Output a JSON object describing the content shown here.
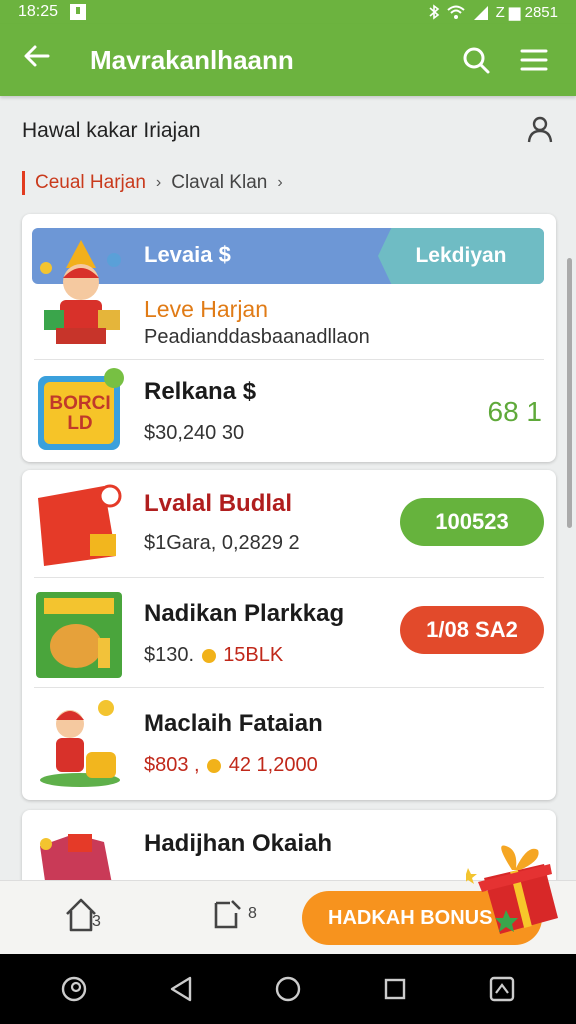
{
  "status_bar": {
    "time": "18:25",
    "right_text": "Z ▆ 2851"
  },
  "app_bar": {
    "title": "Mavrakanlhaann"
  },
  "subheader": {
    "title": "Hawal kakar Iriajan"
  },
  "breadcrumb": {
    "item1": "Ceual Harjan",
    "item2": "Claval Klan"
  },
  "card1": {
    "banner_left": "Levaia $",
    "banner_right": "Lekdiyan",
    "row1": {
      "title": "Leve Harjan",
      "subtitle": "Peadianddasbaanadllaon"
    },
    "row2": {
      "title": "Relkana $",
      "subtitle": "$30,240 30",
      "value": "68 1",
      "thumb_text": "BORCI LD"
    }
  },
  "card2": {
    "row1": {
      "title": "Lvalal Budlal",
      "subtitle": "$1Gara, 0,2829 2",
      "pill": "100523"
    },
    "row2": {
      "title": "Nadikan Plarkkag",
      "subtitle_prefix": "$130.",
      "subtitle_red": "15BLK",
      "pill": "1/08 SA2"
    },
    "row3": {
      "title": "Maclaih Fataian",
      "subtitle_red_prefix": "$803 ,",
      "subtitle_red": "42 1,2000"
    }
  },
  "card3": {
    "row1": {
      "title": "Hadijhan Okaiah"
    }
  },
  "bottom_nav": {
    "home_badge": "3",
    "doc_badge": "8",
    "bonus_label": "HADKAH BONUS"
  },
  "colors": {
    "primary_green": "#6cb33f",
    "accent_orange": "#f7931e",
    "pill_green": "#66b33d",
    "pill_red": "#e24a2b",
    "crumb_red": "#c93a1c"
  }
}
